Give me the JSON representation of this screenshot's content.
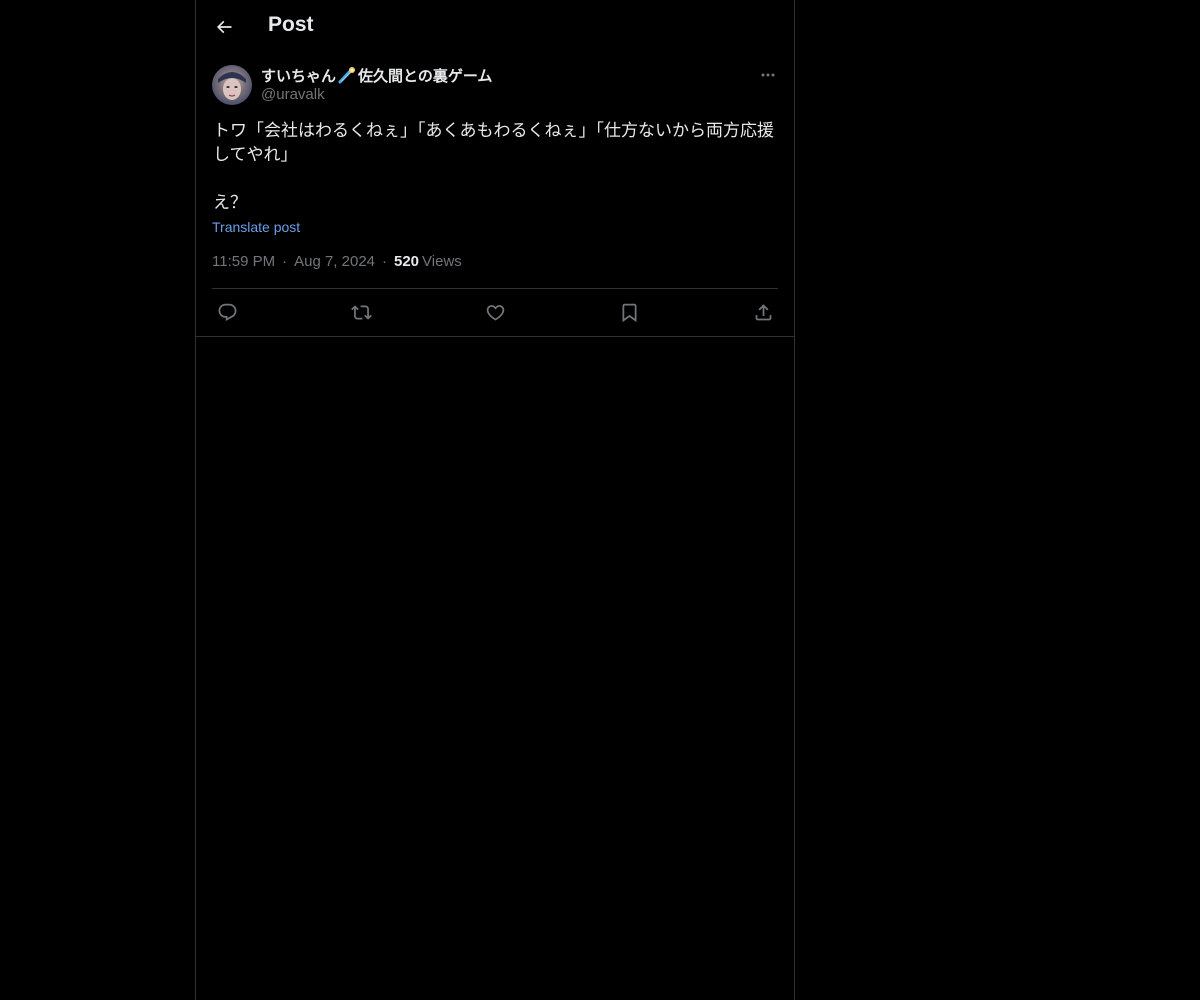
{
  "header": {
    "title": "Post",
    "back_icon": "arrow-left-icon"
  },
  "post": {
    "author": {
      "name_prefix": "すいちゃん",
      "name_emoji": "comet-icon",
      "name_suffix": "佐久間との裏ゲーム",
      "handle": "@uravalk"
    },
    "text": "トワ「会社はわるくねぇ」「あくあもわるくねぇ」「仕方ないから両方応援してやれ」\n\nえ？",
    "translate_label": "Translate post",
    "time": "11:59 PM",
    "date": "Aug 7, 2024",
    "separator": "·",
    "views_count": "520",
    "views_label": "Views"
  },
  "actions": [
    {
      "name": "reply",
      "icon": "reply-icon"
    },
    {
      "name": "repost",
      "icon": "repost-icon"
    },
    {
      "name": "like",
      "icon": "heart-icon"
    },
    {
      "name": "bookmark",
      "icon": "bookmark-icon"
    },
    {
      "name": "share",
      "icon": "share-icon"
    }
  ],
  "colors": {
    "background": "#000000",
    "text": "#e7e9ea",
    "muted": "#71767b",
    "link": "#6b9ee8",
    "border": "#2f3336"
  }
}
